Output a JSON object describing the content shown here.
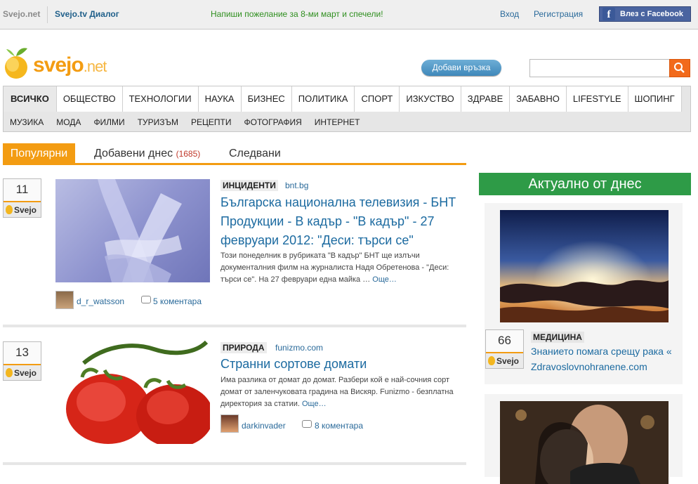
{
  "topbar": {
    "site_label": "Svejo.net",
    "tv_label": "Svejo.tv Диалог",
    "promo": "Напиши пожелание за 8-ми март и спечели!",
    "login": "Вход",
    "register": "Регистрация",
    "facebook_button": "Влез с Facebook"
  },
  "header": {
    "logo_word": "svejo",
    "logo_tld": ".net",
    "add_link_button": "Добави връзка",
    "search_placeholder": ""
  },
  "nav": {
    "primary": [
      "ВСИЧКО",
      "ОБЩЕСТВО",
      "ТЕХНОЛОГИИ",
      "НАУКА",
      "БИЗНЕС",
      "ПОЛИТИКА",
      "СПОРТ",
      "ИЗКУСТВО",
      "ЗДРАВЕ",
      "ЗАБАВНО",
      "LIFESTYLE",
      "ШОПИНГ"
    ],
    "secondary": [
      "МУЗИКА",
      "МОДА",
      "ФИЛМИ",
      "ТУРИЗЪМ",
      "РЕЦЕПТИ",
      "ФОТОГРАФИЯ",
      "ИНТЕРНЕТ"
    ]
  },
  "tabs": {
    "popular": "Популярни",
    "added_today": "Добавени днес",
    "added_today_count": "(1685)",
    "followed": "Следвани"
  },
  "articles": [
    {
      "votes": "11",
      "vote_button": "Svejo",
      "category": "ИНЦИДЕНТИ",
      "source": "bnt.bg",
      "title": "Българска национална телевизия - БНТ Продукции - В кадър - \"В кадър\" - 27 февруари 2012: \"Деси: търси се\"",
      "excerpt": "Този понеделник в рубриката \"В кадър\" БНТ ще излъчи документалния филм на журналиста Надя Обретенова - \"Деси: търси се\". На 27 февруари една майка …",
      "more": "Още…",
      "author": "d_r_watsson",
      "comments": "5 коментара"
    },
    {
      "votes": "13",
      "vote_button": "Svejo",
      "category": "ПРИРОДА",
      "source": "funizmo.com",
      "title": "Странни сортове домати",
      "excerpt": "Има разлика от домат до домат. Разбери кой е най-сочния сорт домат от заленчуковата градина на Вискяр. Funizmo - безплатна директория за статии.",
      "more": "Още…",
      "author": "darkinvader",
      "comments": "8 коментара"
    }
  ],
  "sidebar": {
    "heading": "Актуално от днес",
    "cards": [
      {
        "votes": "66",
        "vote_button": "Svejo",
        "category": "МЕДИЦИНА",
        "title": "Знанието помага срещу рака « Zdravoslovnohranene.com"
      }
    ]
  },
  "colors": {
    "accent": "#f39c12",
    "link": "#1b6aa0",
    "green": "#2e9b47",
    "facebook": "#4a64a0",
    "search_button": "#f26a1b"
  }
}
